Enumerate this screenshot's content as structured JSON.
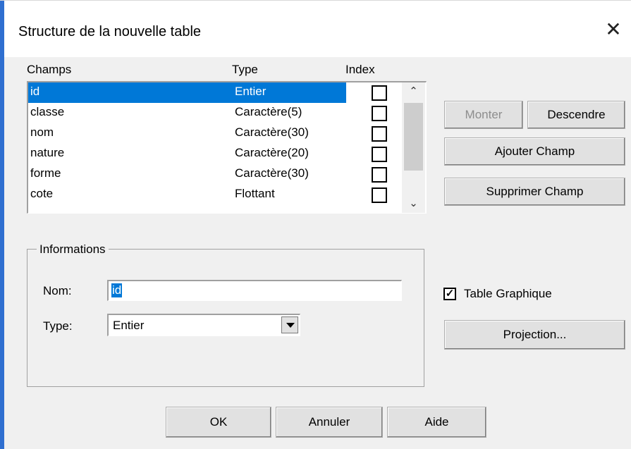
{
  "window": {
    "title": "Structure de la nouvelle table",
    "close_glyph": "✕"
  },
  "fields_list": {
    "headers": {
      "champs": "Champs",
      "type": "Type",
      "index": "Index"
    },
    "rows": [
      {
        "name": "id",
        "type": "Entier",
        "index": false,
        "selected": true
      },
      {
        "name": "classe",
        "type": "Caractère(5)",
        "index": false,
        "selected": false
      },
      {
        "name": "nom",
        "type": "Caractère(30)",
        "index": false,
        "selected": false
      },
      {
        "name": "nature",
        "type": "Caractère(20)",
        "index": false,
        "selected": false
      },
      {
        "name": "forme",
        "type": "Caractère(30)",
        "index": false,
        "selected": false
      },
      {
        "name": "cote",
        "type": "Flottant",
        "index": false,
        "selected": false
      }
    ],
    "scroll_up_glyph": "⌃",
    "scroll_down_glyph": "⌄"
  },
  "buttons": {
    "monter": "Monter",
    "descendre": "Descendre",
    "ajouter": "Ajouter Champ",
    "supprimer": "Supprimer Champ",
    "projection": "Projection...",
    "ok": "OK",
    "annuler": "Annuler",
    "aide": "Aide"
  },
  "informations": {
    "group_label": "Informations",
    "nom_label": "Nom:",
    "nom_value": "id",
    "type_label": "Type:",
    "type_value": "Entier"
  },
  "table_graphique": {
    "label": "Table Graphique",
    "checked": true,
    "check_glyph": "✓"
  },
  "colors": {
    "selection": "#0078d7",
    "dialog_bg": "#f0f0f0",
    "window_edge": "#2f6fd0"
  }
}
